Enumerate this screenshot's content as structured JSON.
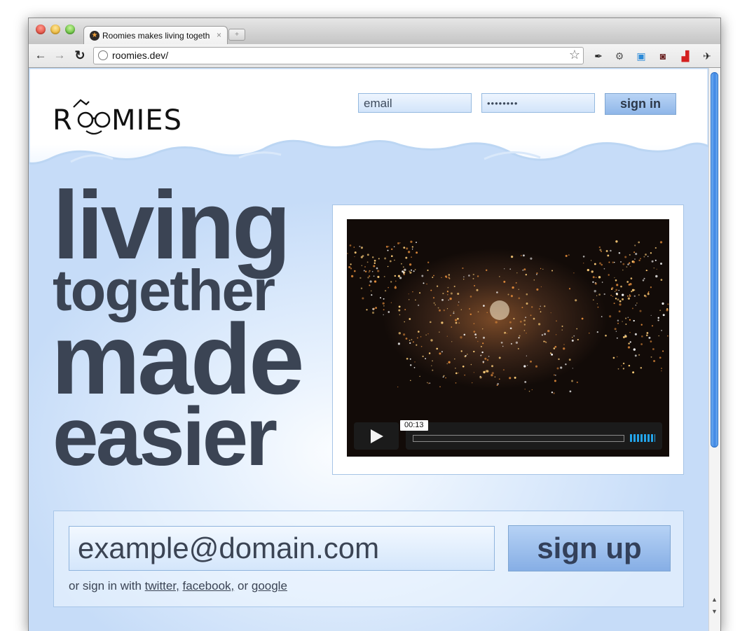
{
  "browser": {
    "tab_title": "Roomies makes living togeth",
    "tab_close": "×",
    "new_tab": "+",
    "url": "roomies.dev/",
    "nav": {
      "back": "←",
      "forward": "→",
      "reload": "↻"
    },
    "bookmark_icon": "☆",
    "extensions": [
      "pen-icon",
      "gear-icon",
      "image-icon",
      "mask-icon",
      "sofa-icon",
      "wrench-icon"
    ]
  },
  "site": {
    "logo_text": "ROOMIES",
    "login": {
      "email_placeholder": "email",
      "password_value": "••••••••",
      "signin_label": "sign in"
    },
    "headline": [
      "living",
      "together",
      "made",
      "easier"
    ],
    "video": {
      "time": "00:13",
      "progress": 0.0
    },
    "signup": {
      "email_placeholder": "example@domain.com",
      "button_label": "sign up",
      "alt_prefix": "or sign in with",
      "alt_twitter": "twitter,",
      "alt_facebook": "facebook,",
      "alt_or": "or",
      "alt_google": "google"
    }
  },
  "colors": {
    "headline": "#3b4454",
    "accent_blue": "#8fb6e8",
    "scroll_thumb": "#3e86e4"
  }
}
